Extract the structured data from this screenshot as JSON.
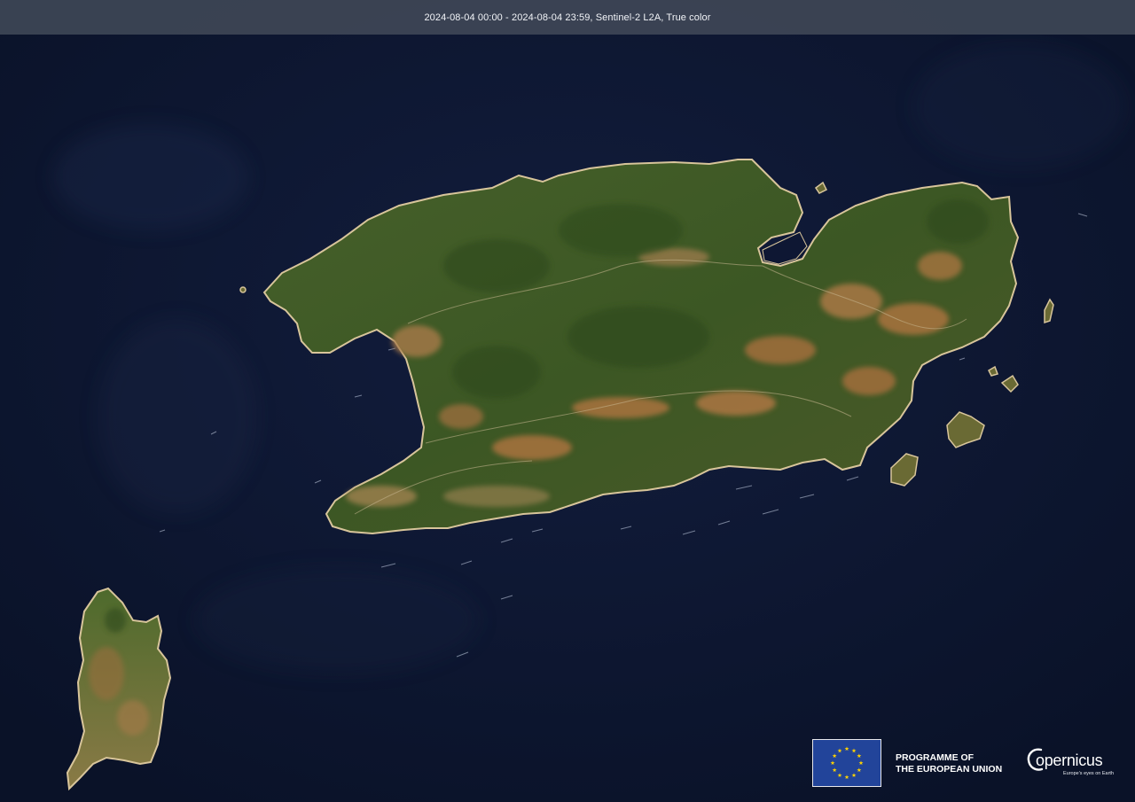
{
  "header": {
    "caption": "2024-08-04 00:00 - 2024-08-04 23:59, Sentinel-2 L2A, True color"
  },
  "map": {
    "imagery": "Sentinel-2 L2A true color",
    "features": [
      "main-island",
      "west-island",
      "east-islets"
    ],
    "colors": {
      "sea": "#0c1530",
      "vegetation": "#3d5a22",
      "bare_soil": "#b4743c",
      "coast": "#d9c39a"
    }
  },
  "footer": {
    "eu_programme": {
      "line1": "PROGRAMME OF",
      "line2": "THE EUROPEAN UNION",
      "flag_icon": "eu-flag-icon"
    },
    "copernicus": {
      "name": "opernicus",
      "tagline": "Europe's eyes on Earth",
      "logo_icon": "copernicus-logo-icon"
    }
  }
}
